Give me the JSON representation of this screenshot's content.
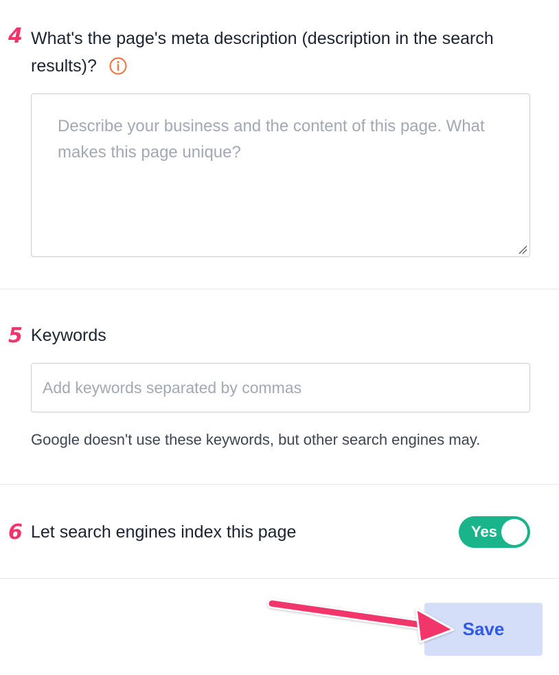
{
  "colors": {
    "step_badge": "#f2346b",
    "toggle_on": "#19b48a",
    "save_bg": "#d5def9",
    "save_text": "#2f5be6",
    "info_icon": "#ef7a46",
    "arrow": "#f2346b"
  },
  "meta_description": {
    "step": "4",
    "question_line1": "What's the page's meta description (description in the search",
    "question_line2": "results)?",
    "info_icon": "info-circle-icon",
    "placeholder_line1": "Describe your business and the content of this page.  What",
    "placeholder_line2": "makes this page unique?",
    "value": ""
  },
  "keywords": {
    "step": "5",
    "label": "Keywords",
    "placeholder": "Add keywords separated by commas",
    "value": "",
    "helper": "Google doesn't use these keywords, but other search engines may."
  },
  "indexing": {
    "step": "6",
    "label": "Let search engines index this page",
    "toggle_label": "Yes",
    "toggle_on": true
  },
  "footer": {
    "save_label": "Save"
  }
}
